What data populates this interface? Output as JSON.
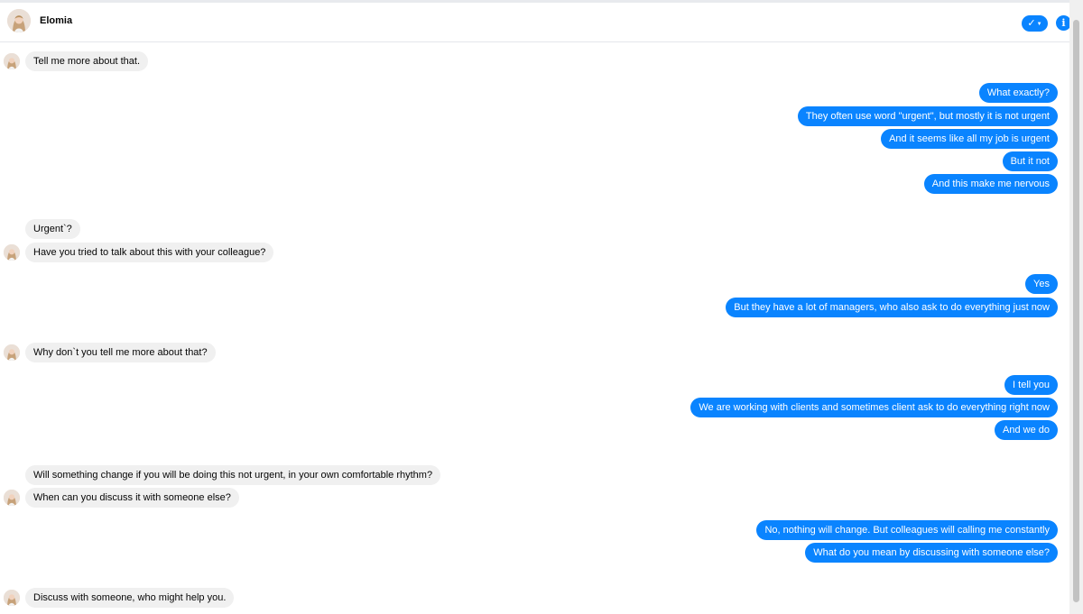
{
  "header": {
    "contact_name": "Elomia"
  },
  "messages": [
    {
      "from": "bot",
      "text": "Tell me more about that."
    },
    {
      "from": "user",
      "text": "What exactly?"
    },
    {
      "from": "user",
      "text": "They often use word \"urgent\", but mostly it is not urgent"
    },
    {
      "from": "user",
      "text": "And it seems like all my job is urgent"
    },
    {
      "from": "user",
      "text": "But it not"
    },
    {
      "from": "user",
      "text": "And this make me nervous"
    },
    {
      "from": "bot",
      "text": "Urgent`?"
    },
    {
      "from": "bot",
      "text": "Have you tried to talk about this with your colleague?"
    },
    {
      "from": "user",
      "text": "Yes"
    },
    {
      "from": "user",
      "text": "But they have a lot of managers, who also ask to do everything just now"
    },
    {
      "from": "bot",
      "text": "Why don`t you tell me more about that?"
    },
    {
      "from": "user",
      "text": "I tell you"
    },
    {
      "from": "user",
      "text": "We are working with clients and sometimes client ask to do everything right now"
    },
    {
      "from": "user",
      "text": "And we do"
    },
    {
      "from": "bot",
      "text": "Will something change if you will be doing this not urgent, in your own comfortable rhythm?"
    },
    {
      "from": "bot",
      "text": "When can you discuss it with someone else?"
    },
    {
      "from": "user",
      "text": "No, nothing will change. But colleagues will calling me constantly"
    },
    {
      "from": "user",
      "text": "What do you mean by discussing with someone else?"
    },
    {
      "from": "bot",
      "text": "Discuss with someone, who might help you."
    }
  ],
  "icons": {
    "status": "check-icon",
    "info": "info-icon"
  },
  "colors": {
    "accent": "#0a84ff",
    "incoming_bubble": "#f0f0f0",
    "outgoing_text": "#ffffff"
  }
}
